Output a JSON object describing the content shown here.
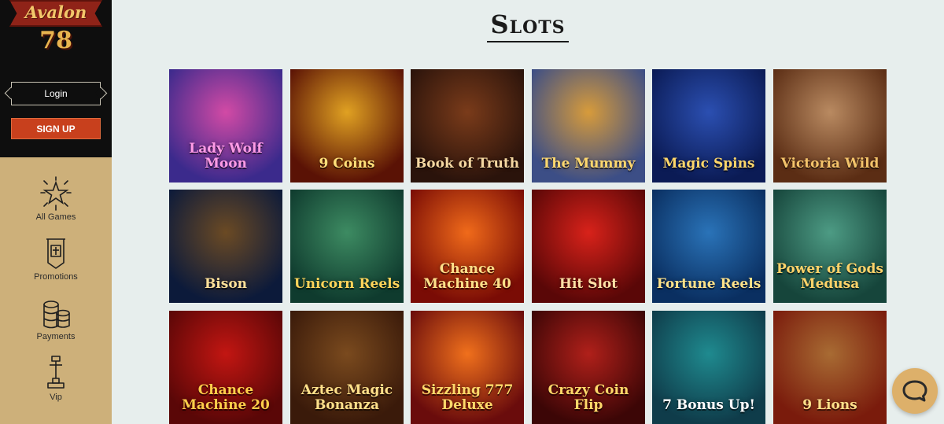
{
  "brand": {
    "name": "Avalon",
    "number": "78"
  },
  "auth": {
    "login_label": "Login",
    "signup_label": "SIGN UP"
  },
  "nav": [
    {
      "label": "All Games",
      "icon": "sparkle-star-icon"
    },
    {
      "label": "Promotions",
      "icon": "promo-banner-icon"
    },
    {
      "label": "Payments",
      "icon": "coins-stack-icon"
    },
    {
      "label": "Vip",
      "icon": "vip-sword-icon"
    }
  ],
  "page": {
    "title": "Slots"
  },
  "games": [
    {
      "name": "Lady Wolf Moon",
      "color_a": "#3b2a8c",
      "color_b": "#d24aa5",
      "text": "#ff9be6"
    },
    {
      "name": "9 Coins",
      "color_a": "#5a1205",
      "color_b": "#e0a122",
      "text": "#ffe07a"
    },
    {
      "name": "Book of Truth",
      "color_a": "#2a130b",
      "color_b": "#7a3b1a",
      "text": "#f4d7a1"
    },
    {
      "name": "The Mummy",
      "color_a": "#3c4e86",
      "color_b": "#d79b3b",
      "text": "#ffd86e"
    },
    {
      "name": "Magic Spins",
      "color_a": "#0b1b55",
      "color_b": "#2b4fb1",
      "text": "#ffd76a"
    },
    {
      "name": "Victoria Wild",
      "color_a": "#5b2d14",
      "color_b": "#b98a61",
      "text": "#f3c36a"
    },
    {
      "name": "Bison",
      "color_a": "#0c1a3a",
      "color_b": "#6b4a24",
      "text": "#ffe19a"
    },
    {
      "name": "Unicorn Reels",
      "color_a": "#0f3b2e",
      "color_b": "#3d8b62",
      "text": "#ffd45a"
    },
    {
      "name": "Chance Machine 40",
      "color_a": "#7a0c05",
      "color_b": "#f06a1a",
      "text": "#ffe08a"
    },
    {
      "name": "Hit Slot",
      "color_a": "#5a0707",
      "color_b": "#d8221a",
      "text": "#ffe0a6"
    },
    {
      "name": "Fortune Reels",
      "color_a": "#0a2f61",
      "color_b": "#2a73b8",
      "text": "#ffe28a"
    },
    {
      "name": "Power of Gods Medusa",
      "color_a": "#16453b",
      "color_b": "#4d9b84",
      "text": "#ffd36a"
    },
    {
      "name": "Chance Machine 20",
      "color_a": "#5a0707",
      "color_b": "#c21612",
      "text": "#ffce4a"
    },
    {
      "name": "Aztec Magic Bonanza",
      "color_a": "#3a1a0a",
      "color_b": "#7a4a1e",
      "text": "#ffe08a"
    },
    {
      "name": "Sizzling 777 Deluxe",
      "color_a": "#6a0c0c",
      "color_b": "#f0701c",
      "text": "#ffd86a"
    },
    {
      "name": "Crazy Coin Flip",
      "color_a": "#3c0606",
      "color_b": "#b0201a",
      "text": "#ffd86a"
    },
    {
      "name": "7 Bonus Up!",
      "color_a": "#0f3c4a",
      "color_b": "#1f8a8f",
      "text": "#ffffff"
    },
    {
      "name": "9 Lions",
      "color_a": "#7a1b0c",
      "color_b": "#a86b33",
      "text": "#ffe08a"
    }
  ],
  "chat": {
    "icon": "chat-bubble-icon"
  }
}
